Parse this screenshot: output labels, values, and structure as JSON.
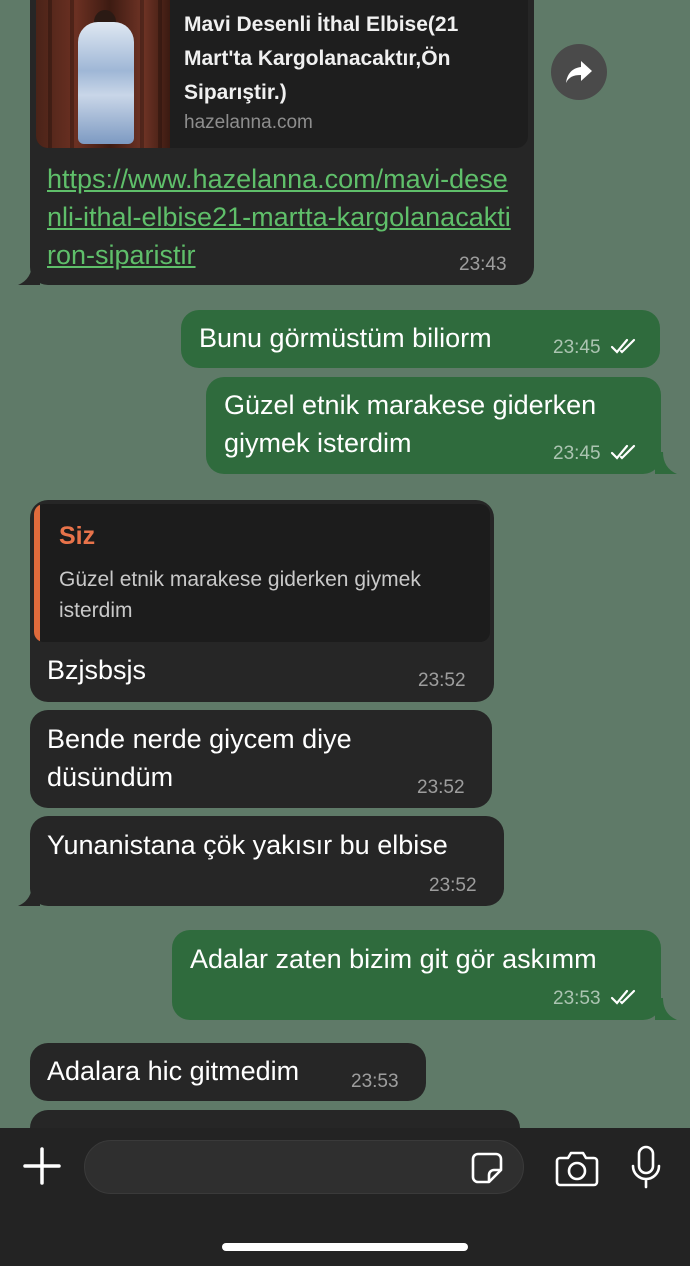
{
  "messages": {
    "m1": {
      "preview_title": "Mavi Desenli İthal Elbise(21 Mart'ta Kargolanacaktır,Ön Siparıştir.)",
      "preview_domain": "hazelanna.com",
      "link": "https://www.hazelanna.com/mavi-desenli-ithal-elbise21-martta-kargolanacaktiron-siparistir",
      "time": "23:43"
    },
    "m2": {
      "text": "Bunu görmüstüm biliorm",
      "time": "23:45"
    },
    "m3": {
      "text": "Güzel etnik marakese giderken giymek isterdim",
      "time": "23:45"
    },
    "m4": {
      "quote_name": "Siz",
      "quote_text": "Güzel etnik marakese giderken giymek isterdim",
      "text": "Bzjsbsjs",
      "time": "23:52"
    },
    "m5": {
      "text": "Bende nerde giycem diye düsündüm",
      "time": "23:52"
    },
    "m6": {
      "text": "Yunanistana çök yakısır bu elbise",
      "time": "23:52"
    },
    "m7": {
      "text": "Adalar zaten bizim git gör askımm",
      "time": "23:53"
    },
    "m8": {
      "text": "Adalara hic gitmedim",
      "time": "23:53"
    }
  },
  "composer": {
    "placeholder": ""
  },
  "icons": {
    "forward": "forward-arrow-icon",
    "attach": "plus-icon",
    "sticker": "sticker-icon",
    "camera": "camera-icon",
    "mic": "microphone-icon",
    "read": "double-check-icon"
  },
  "colors": {
    "background": "#5f7a68",
    "incoming": "#262626",
    "outgoing": "#2f6b3d",
    "link": "#5fbf6a",
    "quote_accent": "#e06b3c"
  }
}
